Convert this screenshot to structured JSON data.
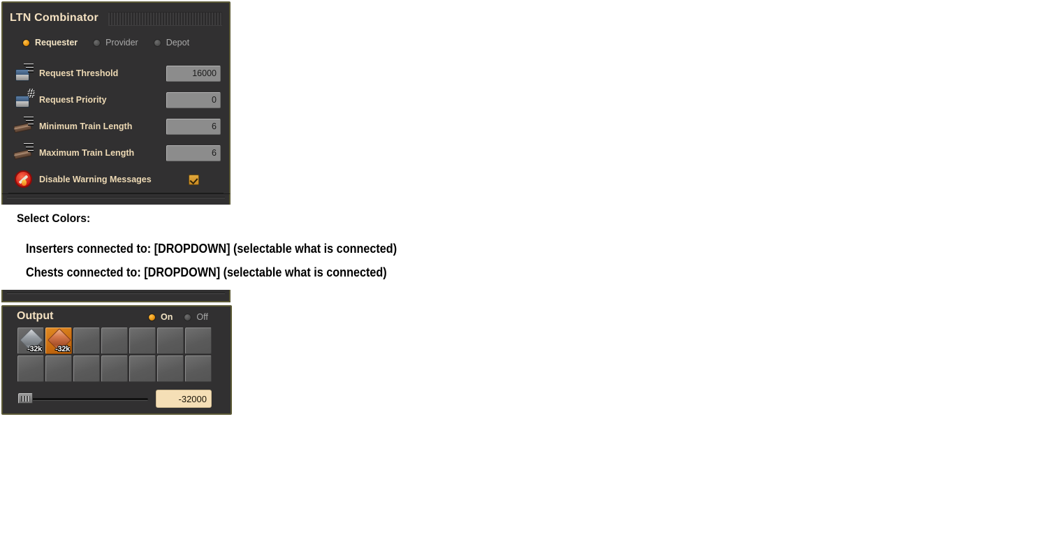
{
  "combinator": {
    "title": "LTN Combinator",
    "modes": [
      {
        "label": "Requester",
        "selected": true
      },
      {
        "label": "Provider",
        "selected": false
      },
      {
        "label": "Depot",
        "selected": false
      }
    ],
    "settings": [
      {
        "icon": "chest-signal-icon",
        "label": "Request Threshold",
        "value": "16000"
      },
      {
        "icon": "chest-hash-icon",
        "label": "Request Priority",
        "value": "0"
      },
      {
        "icon": "rail-signal-icon",
        "label": "Minimum Train Length",
        "value": "6"
      },
      {
        "icon": "rail-signal-icon",
        "label": "Maximum Train Length",
        "value": "6"
      }
    ],
    "disable_warning": {
      "icon": "no-warning-icon",
      "label": "Disable Warning Messages",
      "checked": true
    }
  },
  "notes": {
    "heading": "Select Colors:",
    "line1": "Inserters connected to: [DROPDOWN] (selectable  what is connected)",
    "line2": "Chests connected to: [DROPDOWN] (selectable  what is connected)"
  },
  "output": {
    "title": "Output",
    "toggle": [
      {
        "label": "On",
        "selected": true
      },
      {
        "label": "Off",
        "selected": false
      }
    ],
    "slots": [
      {
        "item": "steel-plate",
        "count": "-32k",
        "selected": false
      },
      {
        "item": "copper-plate",
        "count": "-32k",
        "selected": true
      },
      {
        "item": "",
        "count": "",
        "selected": false
      },
      {
        "item": "",
        "count": "",
        "selected": false
      },
      {
        "item": "",
        "count": "",
        "selected": false
      },
      {
        "item": "",
        "count": "",
        "selected": false
      },
      {
        "item": "",
        "count": "",
        "selected": false
      },
      {
        "item": "",
        "count": "",
        "selected": false
      },
      {
        "item": "",
        "count": "",
        "selected": false
      },
      {
        "item": "",
        "count": "",
        "selected": false
      },
      {
        "item": "",
        "count": "",
        "selected": false
      },
      {
        "item": "",
        "count": "",
        "selected": false
      },
      {
        "item": "",
        "count": "",
        "selected": false
      },
      {
        "item": "",
        "count": "",
        "selected": false
      }
    ],
    "slider_value": "-32000",
    "value_field": "-32000"
  },
  "colors": {
    "panel_bg": "#313031",
    "panel_border": "#5c5a36",
    "title_text": "#f4e1c1",
    "label_text": "#edd9b4",
    "accent_orange": "#e8930e",
    "input_bg": "#8c8c8c",
    "value_field_bg": "#f5dfb6"
  }
}
